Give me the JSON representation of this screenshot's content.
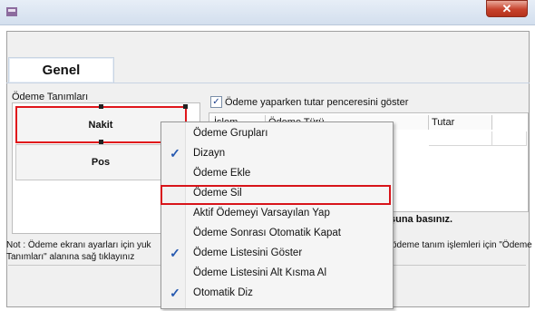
{
  "window": {
    "close_label": "✕"
  },
  "tabs": [
    {
      "label": "Genel"
    }
  ],
  "payments": {
    "group_label": "Ödeme Tanımları",
    "buttons": [
      {
        "label": "Nakit"
      },
      {
        "label": "Pos"
      }
    ]
  },
  "amount_window": {
    "checkbox_label": "Ödeme yaparken tutar penceresini göster",
    "checked": true
  },
  "grid": {
    "columns": [
      "İşlem",
      "Ödeme Türü",
      "Tutar"
    ]
  },
  "hint_text": "şuna basınız.",
  "note": {
    "left_text": "Not : Ödeme ekranı ayarları için yuk",
    "left_text2": "Tanımları\" alanına sağ tıklayınız",
    "right_text": "ödeme tanım işlemleri için \"Ödeme"
  },
  "context_menu": {
    "items": [
      {
        "label": "Ödeme Grupları",
        "checked": false
      },
      {
        "label": "Dizayn",
        "checked": true
      },
      {
        "label": "Ödeme Ekle",
        "checked": false
      },
      {
        "label": "Ödeme Sil",
        "checked": false,
        "highlighted": true
      },
      {
        "label": "Aktif Ödemeyi Varsayılan Yap",
        "checked": false
      },
      {
        "label": "Ödeme Sonrası Otomatik Kapat",
        "checked": false
      },
      {
        "label": "Ödeme Listesini Göster",
        "checked": true
      },
      {
        "label": "Ödeme Listesini Alt Kısma Al",
        "checked": false
      },
      {
        "label": "Otomatik Diz",
        "checked": true
      }
    ]
  },
  "colors": {
    "highlight_red": "#e0161b",
    "check_blue": "#2659b0"
  }
}
